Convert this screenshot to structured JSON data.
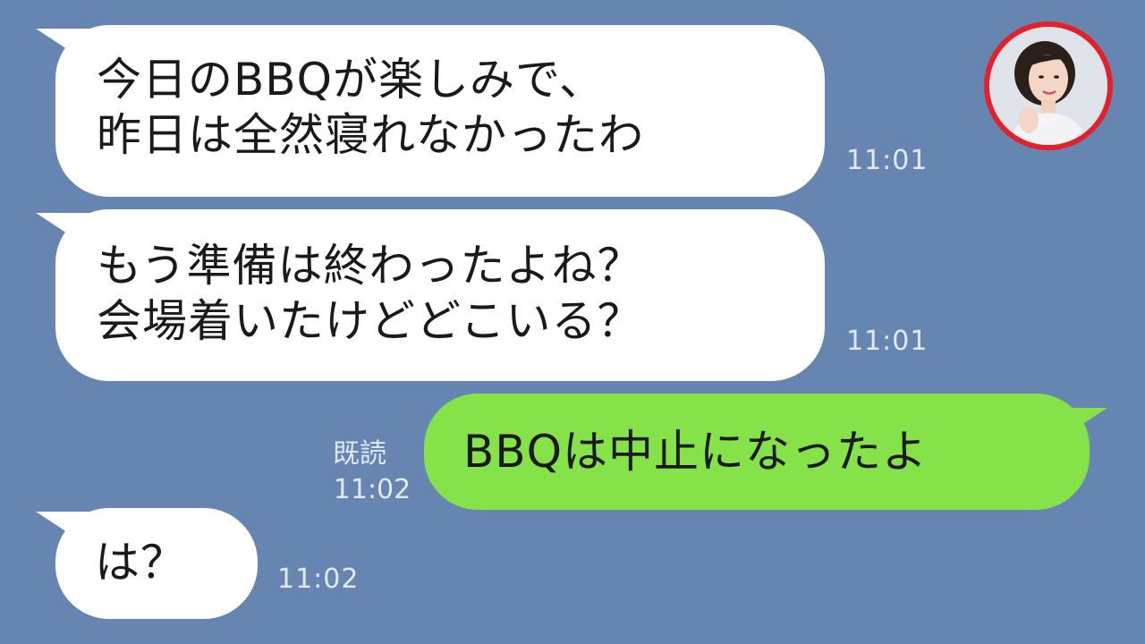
{
  "conversation": {
    "messages": [
      {
        "side": "received",
        "lines": [
          "今日のBBQが楽しみで、",
          "昨日は全然寝れなかったわ"
        ],
        "time": "11:01"
      },
      {
        "side": "received",
        "lines": [
          "もう準備は終わったよね？",
          "会場着いたけどどこいる？"
        ],
        "time": "11:01"
      },
      {
        "side": "sent",
        "lines": [
          "BBQは中止になったよ"
        ],
        "read_label": "既読",
        "time": "11:02"
      },
      {
        "side": "received",
        "lines": [
          "は？"
        ],
        "time": "11:02"
      }
    ]
  },
  "colors": {
    "background": "#6685b1",
    "received_bubble": "#ffffff",
    "sent_bubble": "#85e249",
    "avatar_ring": "#e3212c",
    "meta_text": "#e2e9f3"
  },
  "avatar": {
    "icon": "profile-photo-woman"
  }
}
